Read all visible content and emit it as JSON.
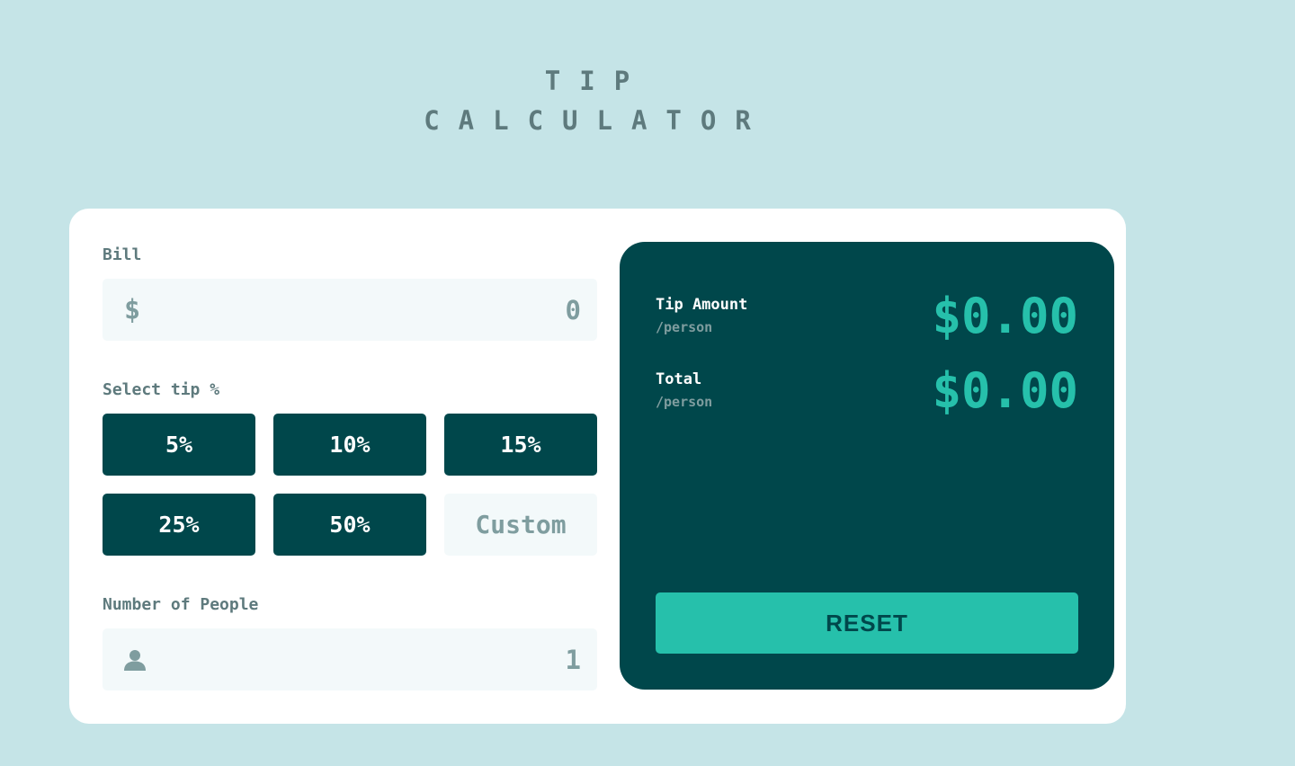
{
  "logo": {
    "line1": "TIP",
    "line2": "CALCULATOR"
  },
  "bill": {
    "label": "Bill",
    "currency_symbol": "$",
    "placeholder": "0"
  },
  "tip": {
    "label": "Select tip %",
    "options": [
      "5%",
      "10%",
      "15%",
      "25%",
      "50%"
    ],
    "custom_placeholder": "Custom"
  },
  "people": {
    "label": "Number of People",
    "placeholder": "1",
    "icon": "person-icon"
  },
  "results": {
    "tip_amount": {
      "title": "Tip Amount",
      "sub": "/person",
      "value": "$0.00"
    },
    "total": {
      "title": "Total",
      "sub": "/person",
      "value": "$0.00"
    },
    "reset_label": "RESET"
  },
  "colors": {
    "background": "#c5e4e7",
    "card": "#ffffff",
    "dark_cyan": "#00474b",
    "accent": "#26c0ab",
    "input_bg": "#f3f9fa",
    "muted": "#5e7a7d",
    "placeholder": "#7f9d9f"
  }
}
